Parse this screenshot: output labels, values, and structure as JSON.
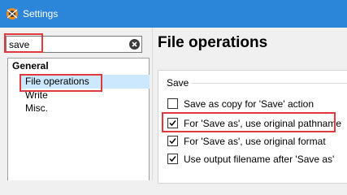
{
  "window": {
    "title": "Settings"
  },
  "search": {
    "value": "save"
  },
  "tree": {
    "group": "General",
    "items": [
      "File operations",
      "Write",
      "Misc."
    ]
  },
  "page": {
    "heading": "File operations"
  },
  "save_group": {
    "label": "Save",
    "options": [
      {
        "label": "Save as copy for 'Save' action",
        "checked": false
      },
      {
        "label": "For 'Save as', use original pathname",
        "checked": true
      },
      {
        "label": "For 'Save as', use original format",
        "checked": true
      },
      {
        "label": "Use output filename after 'Save as'",
        "checked": true
      }
    ]
  },
  "colors": {
    "titlebar": "#2b85d9",
    "highlight": "#e0393e",
    "selection": "#cce8ff"
  }
}
